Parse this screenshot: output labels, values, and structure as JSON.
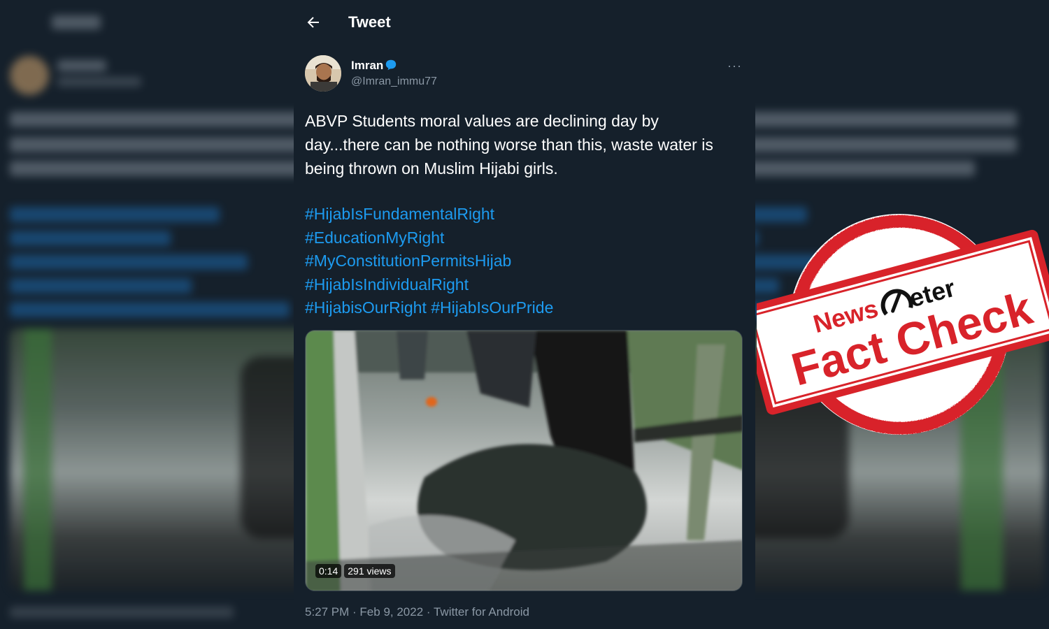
{
  "colors": {
    "background": "#15202b",
    "accent_link": "#1d9bf0",
    "text_primary": "#ffffff",
    "text_secondary": "#8b98a5",
    "stamp_red": "#d8232a"
  },
  "header": {
    "title": "Tweet",
    "back_icon": "arrow-left-icon"
  },
  "tweet": {
    "author": {
      "display_name": "Imran",
      "handle": "@Imran_immu77",
      "verified_icon": "speech-bubble-icon"
    },
    "more_icon": "more-horizontal-icon",
    "more_label": "···",
    "text": "ABVP Students moral values are declining day by day...there can be nothing worse than this, waste water is being thrown on Muslim Hijabi girls.",
    "hashtags": [
      "#HijabIsFundamentalRight",
      "#EducationMyRight",
      "#MyConstitutionPermitsHijab",
      "#HijabIsIndividualRight",
      "#HijabisOurRight",
      "#HijabIsOurPride"
    ],
    "media": {
      "type": "video",
      "duration": "0:14",
      "views": "291 views"
    },
    "meta": {
      "time": "5:27 PM",
      "separator": " · ",
      "date": "Feb 9, 2022",
      "source": "Twitter for Android"
    }
  },
  "stamp": {
    "brand_left": "News",
    "brand_right": "eter",
    "headline": "Fact Check",
    "logo_icon": "speedometer-icon"
  }
}
